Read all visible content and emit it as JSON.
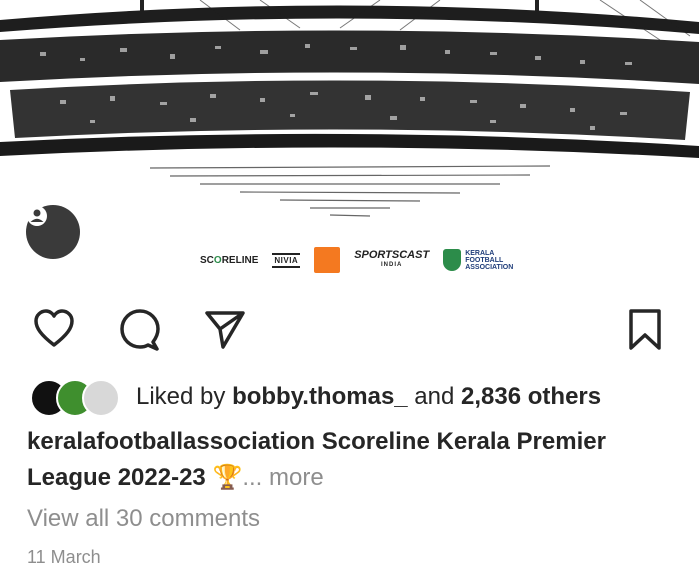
{
  "post": {
    "sponsors": {
      "scoreline": "SC",
      "scoreline_o": "O",
      "scoreline_rest": "RELINE",
      "nivia": "NIVIA",
      "sportscast": "SPORTSCAST",
      "sportscast_sub": "INDIA",
      "kfa_line1": "KERALA",
      "kfa_line2": "FOOTBALL",
      "kfa_line3": "ASSOCIATION"
    }
  },
  "likes": {
    "prefix": "Liked by ",
    "user": "bobby.thomas_",
    "middle": " and ",
    "others": "2,836 others"
  },
  "caption": {
    "username": "keralafootballassociation",
    "title": "Scoreline Kerala Premier League 2022-23",
    "emoji": "🏆",
    "ellipsis": "...",
    "more": "more"
  },
  "comments_link": "View all 30 comments",
  "date": "11 March",
  "colors": {
    "text": "#262626",
    "secondary": "#8e8e8e",
    "background": "#ffffff"
  }
}
